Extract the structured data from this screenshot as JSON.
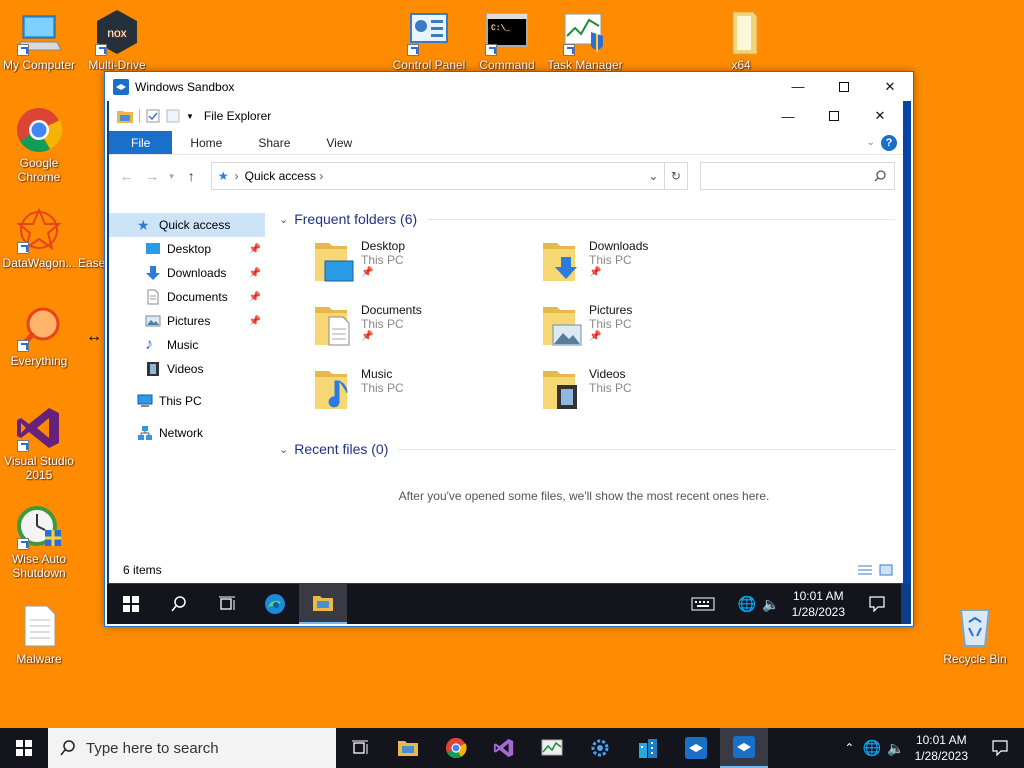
{
  "desktop": {
    "icons": [
      {
        "label": "My Computer"
      },
      {
        "label": "Multi-Drive"
      },
      {
        "label": "Google Chrome"
      },
      {
        "label": "DataWagon..."
      },
      {
        "label": "Ease"
      },
      {
        "label": "Everything"
      },
      {
        "label": "Visual Studio 2015"
      },
      {
        "label": "Wise Auto Shutdown"
      },
      {
        "label": "Malware"
      },
      {
        "label": "Control Panel"
      },
      {
        "label": "Command"
      },
      {
        "label": "Task Manager"
      },
      {
        "label": "x64"
      },
      {
        "label": "Recycle Bin"
      }
    ]
  },
  "sandbox": {
    "title": "Windows Sandbox"
  },
  "explorer": {
    "title": "File Explorer",
    "ribbon": {
      "file": "File",
      "home": "Home",
      "share": "Share",
      "view": "View"
    },
    "address": "Quick access",
    "nav": {
      "quick_access": "Quick access",
      "desktop": "Desktop",
      "downloads": "Downloads",
      "documents": "Documents",
      "pictures": "Pictures",
      "music": "Music",
      "videos": "Videos",
      "this_pc": "This PC",
      "network": "Network"
    },
    "frequent_header": "Frequent folders (6)",
    "folders": [
      {
        "name": "Desktop",
        "location": "This PC",
        "pinned": true
      },
      {
        "name": "Downloads",
        "location": "This PC",
        "pinned": true
      },
      {
        "name": "Documents",
        "location": "This PC",
        "pinned": true
      },
      {
        "name": "Pictures",
        "location": "This PC",
        "pinned": true
      },
      {
        "name": "Music",
        "location": "This PC",
        "pinned": false
      },
      {
        "name": "Videos",
        "location": "This PC",
        "pinned": false
      }
    ],
    "recent_header": "Recent files (0)",
    "recent_empty": "After you've opened some files, we'll show the most recent ones here.",
    "status": "6 items"
  },
  "vm_taskbar": {
    "time": "10:01 AM",
    "date": "1/28/2023"
  },
  "taskbar": {
    "search_placeholder": "Type here to search",
    "time": "10:01 AM",
    "date": "1/28/2023"
  },
  "colors": {
    "desktop": "#ff8c00",
    "accent": "#1a6fc9",
    "taskbar": "#14141c"
  }
}
